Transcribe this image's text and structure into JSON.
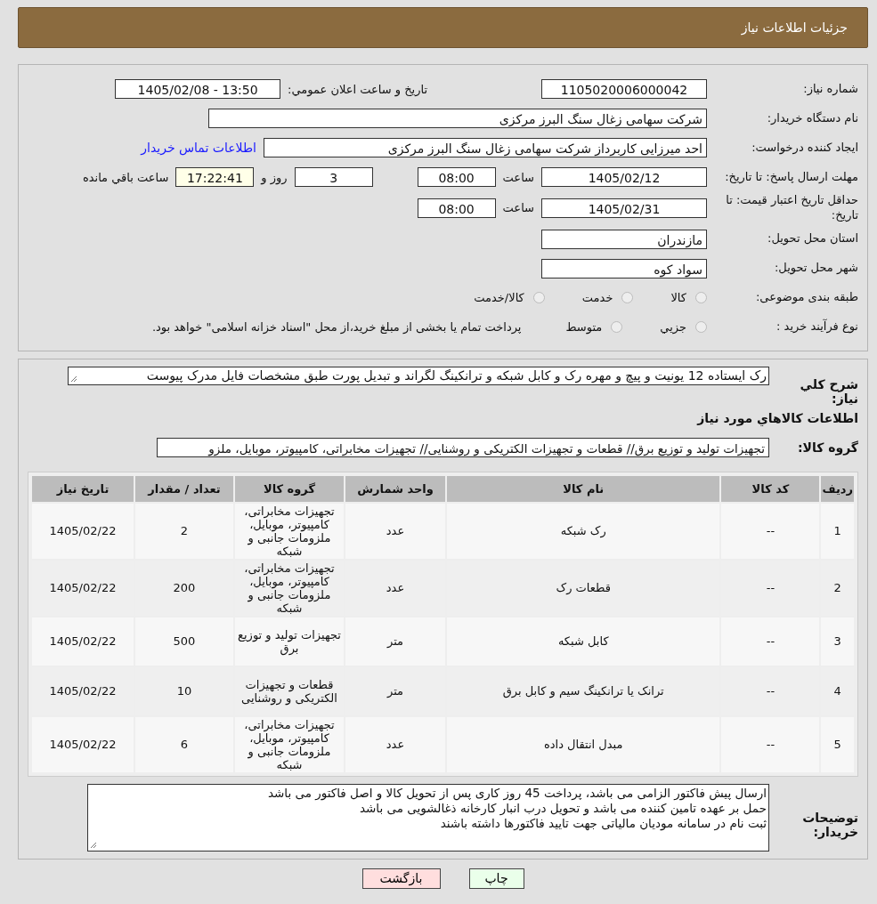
{
  "header": {
    "title": "جزئیات اطلاعات نیاز"
  },
  "form": {
    "need_number": {
      "label": "شماره نیاز:",
      "value": "1105020006000042"
    },
    "announce": {
      "label": "تاریخ و ساعت اعلان عمومي:",
      "value": "1405/02/08 - 13:50"
    },
    "buyer": {
      "label": "نام دستگاه خریدار:",
      "value": "شرکت سهامی زغال سنگ البرز مرکزی"
    },
    "creator": {
      "label": "ایجاد کننده درخواست:",
      "value": "احد میرزایی کاربرداز شرکت سهامی زغال سنگ البرز مرکزی",
      "link": "اطلاعات تماس خریدار"
    },
    "deadline": {
      "label": "مهلت ارسال پاسخ: تا تاریخ:",
      "date": "1405/02/12",
      "time_label": "ساعت",
      "time": "08:00",
      "days": "3",
      "days_label": "روز و",
      "remaining": "17:22:41",
      "remaining_label": "ساعت باقي مانده"
    },
    "validity": {
      "label": "حداقل تاریخ اعتبار قیمت: تا تاریخ:",
      "date": "1405/02/31",
      "time_label": "ساعت",
      "time": "08:00"
    },
    "province": {
      "label": "استان محل تحویل:",
      "value": "مازندران"
    },
    "city": {
      "label": "شهر محل تحویل:",
      "value": "سواد کوه"
    },
    "category": {
      "label": "طبقه بندی موضوعی:",
      "options": [
        {
          "label": "کالا",
          "selected": false
        },
        {
          "label": "خدمت",
          "selected": false
        },
        {
          "label": "کالا/خدمت",
          "selected": false
        }
      ]
    },
    "process": {
      "label": "نوع فرآیند خرید :",
      "options": [
        {
          "label": "جزيي",
          "selected": false
        },
        {
          "label": "متوسط",
          "selected": false
        }
      ],
      "note": "پرداخت تمام یا بخشی از مبلغ خرید،از محل \"اسناد خزانه اسلامی\" خواهد بود."
    }
  },
  "summary": {
    "label": "شرح کلي نیاز:",
    "value": "رک ایستاده 12 یونیت و پیچ و مهره رک و کابل شبکه و ترانکینگ لگراند و تبدیل پورت طبق مشخصات فایل مدرک پیوست"
  },
  "goods_title": "اطلاعات کالاهاي مورد نیاز",
  "goods_group": {
    "label": "گروه کالا:",
    "value": "تجهیزات تولید و توزیع برق// قطعات و تجهیزات الکتریکی و روشنایی// تجهیزات مخابراتی، کامپیوتر، موبایل، ملزو"
  },
  "table": {
    "columns": [
      "ردیف",
      "کد کالا",
      "نام کالا",
      "واحد شمارش",
      "گروه کالا",
      "تعداد / مقدار",
      "تاریخ نیاز"
    ],
    "rows": [
      [
        "1",
        "--",
        "رک شبکه",
        "عدد",
        "تجهیزات مخابراتی، کامپیوتر، موبایل، ملزومات جانبی و شبکه",
        "2",
        "1405/02/22"
      ],
      [
        "2",
        "--",
        "قطعات رک",
        "عدد",
        "تجهیزات مخابراتی، کامپیوتر، موبایل، ملزومات جانبی و شبکه",
        "200",
        "1405/02/22"
      ],
      [
        "3",
        "--",
        "کابل شبکه",
        "متر",
        "تجهیزات تولید و توزیع برق",
        "500",
        "1405/02/22"
      ],
      [
        "4",
        "--",
        "ترانک یا ترانکینگ سیم و کابل برق",
        "متر",
        "قطعات و تجهیزات الکتریکی و روشنایی",
        "10",
        "1405/02/22"
      ],
      [
        "5",
        "--",
        "مبدل انتقال داده",
        "عدد",
        "تجهیزات مخابراتی، کامپیوتر، موبایل، ملزومات جانبی و شبکه",
        "6",
        "1405/02/22"
      ]
    ]
  },
  "buyer_notes": {
    "label": "توضیحات خریدار:",
    "lines": [
      "ارسال پیش فاکتور الزامی می باشد، پرداخت 45 روز کاری پس از تحویل کالا و اصل فاکتور می باشد",
      "حمل بر عهده تامین کننده می باشد و تحویل درب انبار کارخانه ذغالشویی می باشد",
      "ثبت نام در سامانه مودیان مالیاتی جهت تایید فاکتورها داشته باشند"
    ]
  },
  "buttons": [
    {
      "label": "چاپ",
      "kind": "print"
    },
    {
      "label": "بازگشت",
      "kind": "back"
    }
  ]
}
